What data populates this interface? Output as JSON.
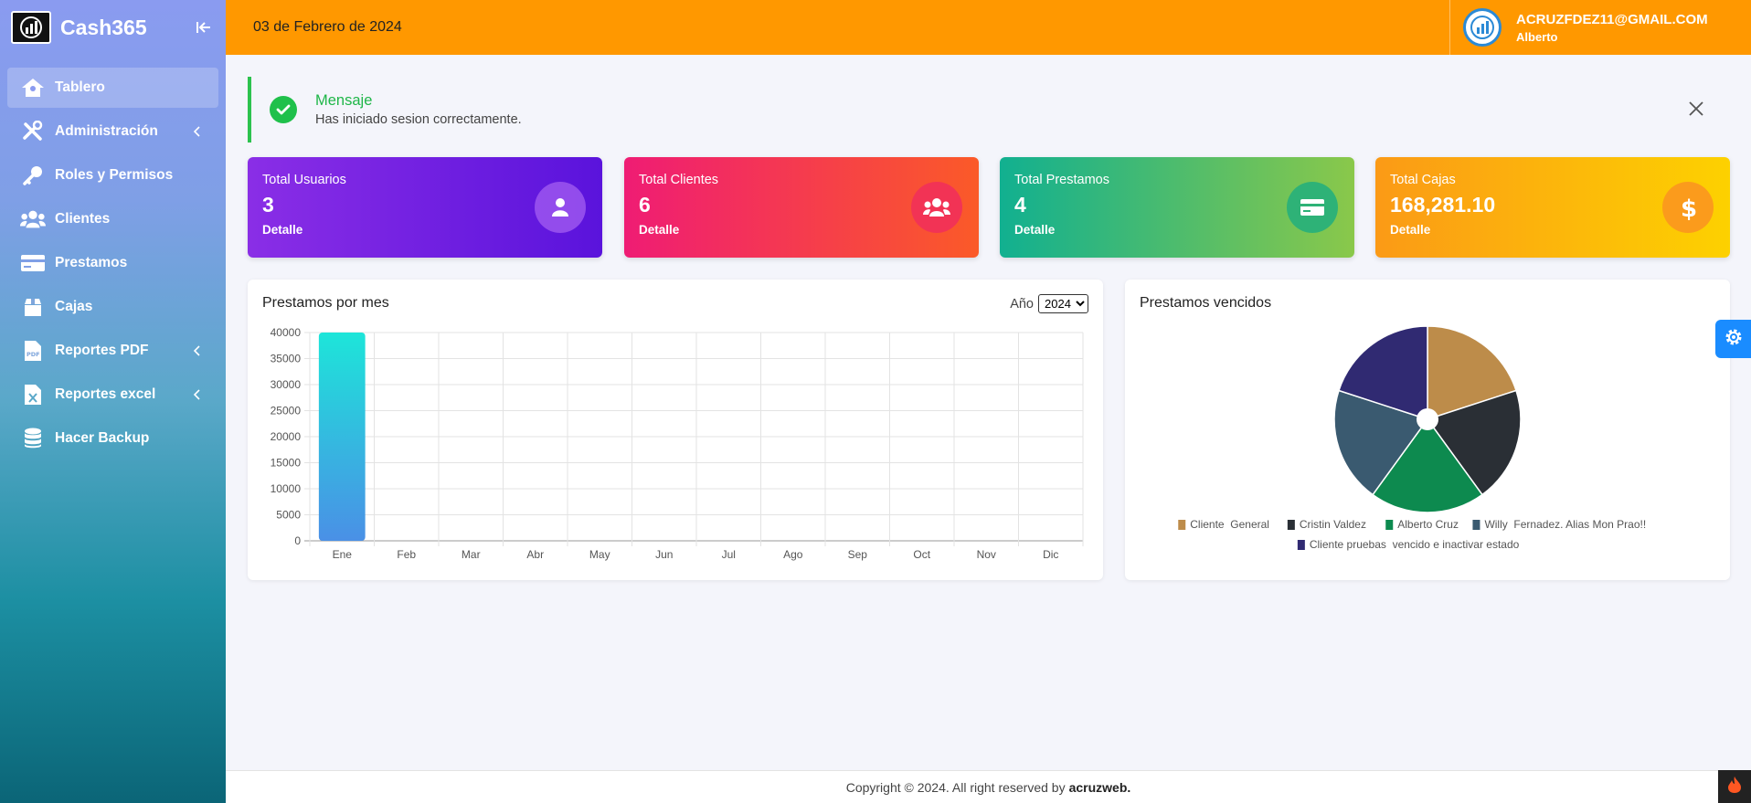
{
  "app": {
    "name": "Cash365"
  },
  "sidebar": {
    "items": [
      {
        "label": "Tablero",
        "icon": "home-icon",
        "active": true
      },
      {
        "label": "Administración",
        "icon": "tools-icon"
      },
      {
        "label": "Roles y Permisos",
        "icon": "key-icon"
      },
      {
        "label": "Clientes",
        "icon": "users-icon"
      },
      {
        "label": "Prestamos",
        "icon": "credit-card-icon"
      },
      {
        "label": "Cajas",
        "icon": "box-icon"
      },
      {
        "label": "Reportes PDF",
        "icon": "pdf-file-icon"
      },
      {
        "label": "Reportes excel",
        "icon": "excel-file-icon"
      },
      {
        "label": "Hacer Backup",
        "icon": "database-icon"
      }
    ]
  },
  "header": {
    "date": "03 de Febrero de 2024",
    "user_email": "ACRUZFDEZ11@GMAIL.COM",
    "user_name": "Alberto"
  },
  "alert": {
    "title": "Mensaje",
    "message": "Has iniciado sesion correctamente."
  },
  "cards": [
    {
      "label": "Total Usuarios",
      "value": "3",
      "detail": "Detalle",
      "icon": "user-icon"
    },
    {
      "label": "Total Clientes",
      "value": "6",
      "detail": "Detalle",
      "icon": "users-icon"
    },
    {
      "label": "Total Prestamos",
      "value": "4",
      "detail": "Detalle",
      "icon": "credit-card-icon"
    },
    {
      "label": "Total Cajas",
      "value": "168,281.10",
      "detail": "Detalle",
      "icon": "dollar-icon"
    }
  ],
  "bar_panel": {
    "title": "Prestamos por mes",
    "year_label": "Año",
    "year_value": "2024"
  },
  "pie_panel": {
    "title": "Prestamos vencidos"
  },
  "colors": {
    "topbar": "#ff9800",
    "bar_top": "#1de5d9",
    "bar_bottom": "#4a90e6"
  },
  "chart_data": [
    {
      "type": "bar",
      "title": "Prestamos por mes",
      "categories": [
        "Ene",
        "Feb",
        "Mar",
        "Abr",
        "May",
        "Jun",
        "Jul",
        "Ago",
        "Sep",
        "Oct",
        "Nov",
        "Dic"
      ],
      "values": [
        40000,
        0,
        0,
        0,
        0,
        0,
        0,
        0,
        0,
        0,
        0,
        0
      ],
      "yticks": [
        0,
        5000,
        10000,
        15000,
        20000,
        25000,
        30000,
        35000,
        40000
      ],
      "ylim": [
        0,
        40000
      ],
      "grid": true
    },
    {
      "type": "pie",
      "title": "Prestamos vencidos",
      "labels": [
        "Cliente  General",
        "Cristin Valdez",
        "Alberto Cruz",
        "Willy  Fernadez. Alias Mon Prao!!",
        "Cliente pruebas  vencido e inactivar estado"
      ],
      "values": [
        1,
        1,
        1,
        1,
        1
      ],
      "colors": [
        "#bd8c4a",
        "#2a2f35",
        "#0d8a4f",
        "#3a5a70",
        "#302a72"
      ],
      "legend": "bottom"
    }
  ],
  "footer": {
    "copyright": "Copyright © 2024. All right reserved by",
    "brand": "acruzweb."
  }
}
